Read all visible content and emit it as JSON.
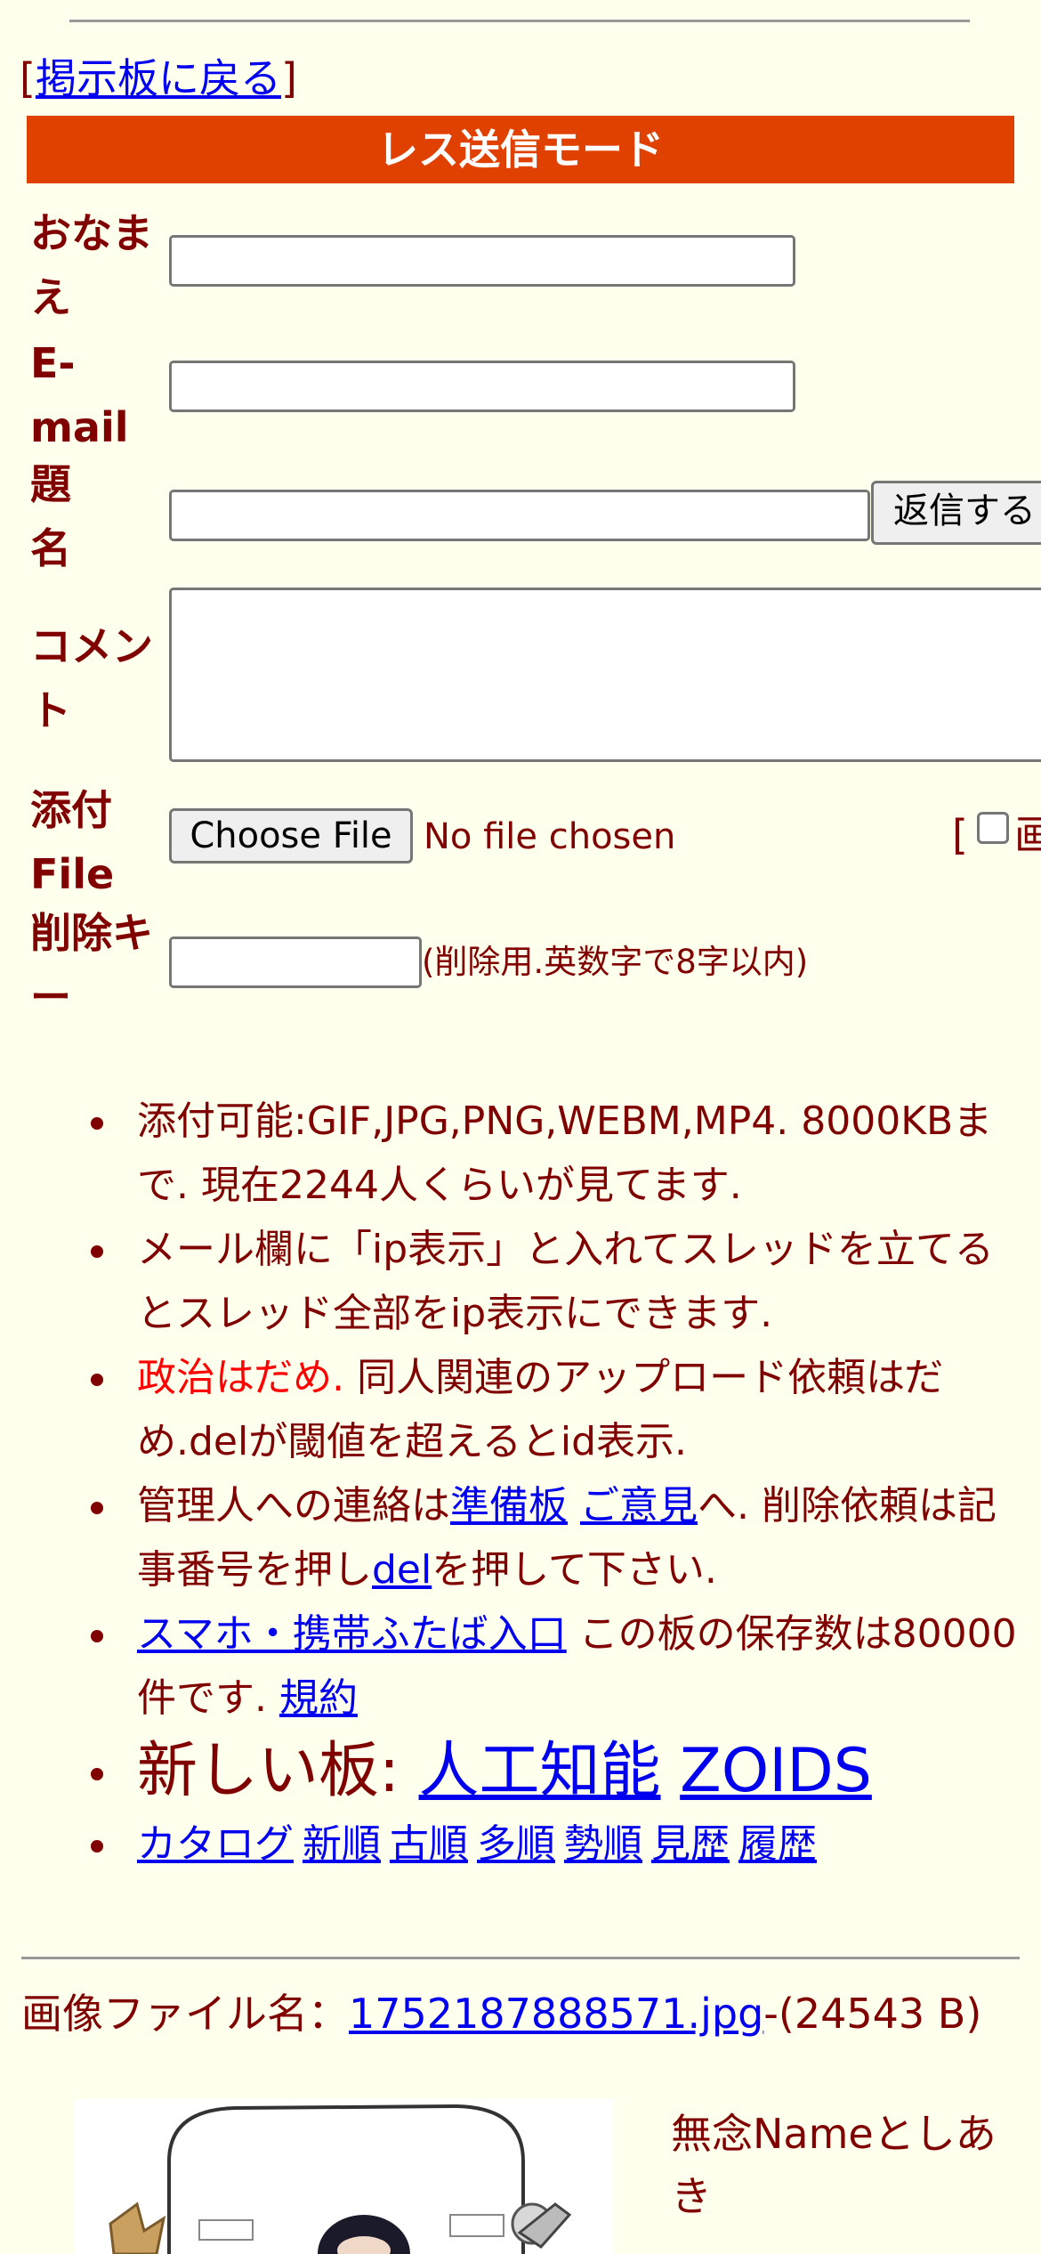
{
  "back_link": {
    "bracket_open": "[",
    "label": "掲示板に戻る",
    "bracket_close": "]"
  },
  "mode_banner": "レス送信モード",
  "form": {
    "name_label_1": "おなま",
    "name_label_2": "え",
    "email_label_1": "E-",
    "email_label_2": "mail",
    "subject_label_1": "題",
    "subject_label_2": "名",
    "submit_button": "返信する",
    "comment_label_1": "コメン",
    "comment_label_2": "ト",
    "file_label_1": "添付",
    "file_label_2": "File",
    "choose_file_button": "Choose File",
    "no_file_text": "No file chosen",
    "image_option_bracket": "[",
    "image_option_label": "画",
    "delete_key_label_1": "削除キ",
    "delete_key_label_2": "ー",
    "delete_key_hint": "(削除用.英数字で8字以内)"
  },
  "notes": {
    "item1": "添付可能:GIF,JPG,PNG,WEBM,MP4. 8000KBまで. 現在2244人くらいが見てます.",
    "item2": "メール欄に「ip表示」と入れてスレッドを立てるとスレッド全部をip表示にできます.",
    "item3_red": "政治はだめ.",
    "item3_rest": " 同人関連のアップロード依頼はだめ.delが閾値を超えるとid表示.",
    "item4_prefix": "管理人への連絡は",
    "item4_link1": "準備板",
    "item4_sep": " ",
    "item4_link2": "ご意見",
    "item4_middle": "へ. 削除依頼は記事番号を押し",
    "item4_link3": "del",
    "item4_suffix": "を押して下さい.",
    "item5_link": "スマホ・携帯ふたば入口",
    "item5_text": " この板の保存数は80000件です. ",
    "item5_link2": "規約",
    "item6_prefix": "新しい板: ",
    "item6_link1": "人工知能",
    "item6_link2": "ZOIDS",
    "catalog_links": [
      "カタログ",
      "新順",
      "古順",
      "多順",
      "勢順",
      "見歴",
      "履歴"
    ]
  },
  "post": {
    "file_label": "画像ファイル名：",
    "file_name": "1752187888571.jpg",
    "file_size": "-(24543 B)",
    "name_text": "無念Nameとしあき"
  }
}
